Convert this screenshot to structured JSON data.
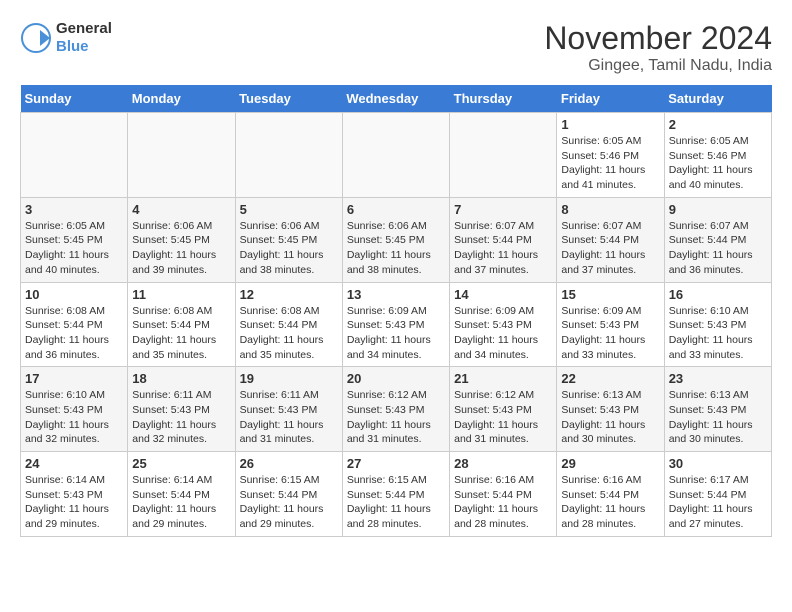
{
  "logo": {
    "line1": "General",
    "line2": "Blue"
  },
  "title": "November 2024",
  "subtitle": "Gingee, Tamil Nadu, India",
  "weekdays": [
    "Sunday",
    "Monday",
    "Tuesday",
    "Wednesday",
    "Thursday",
    "Friday",
    "Saturday"
  ],
  "weeks": [
    [
      {
        "day": "",
        "info": ""
      },
      {
        "day": "",
        "info": ""
      },
      {
        "day": "",
        "info": ""
      },
      {
        "day": "",
        "info": ""
      },
      {
        "day": "",
        "info": ""
      },
      {
        "day": "1",
        "info": "Sunrise: 6:05 AM\nSunset: 5:46 PM\nDaylight: 11 hours and 41 minutes."
      },
      {
        "day": "2",
        "info": "Sunrise: 6:05 AM\nSunset: 5:46 PM\nDaylight: 11 hours and 40 minutes."
      }
    ],
    [
      {
        "day": "3",
        "info": "Sunrise: 6:05 AM\nSunset: 5:45 PM\nDaylight: 11 hours and 40 minutes."
      },
      {
        "day": "4",
        "info": "Sunrise: 6:06 AM\nSunset: 5:45 PM\nDaylight: 11 hours and 39 minutes."
      },
      {
        "day": "5",
        "info": "Sunrise: 6:06 AM\nSunset: 5:45 PM\nDaylight: 11 hours and 38 minutes."
      },
      {
        "day": "6",
        "info": "Sunrise: 6:06 AM\nSunset: 5:45 PM\nDaylight: 11 hours and 38 minutes."
      },
      {
        "day": "7",
        "info": "Sunrise: 6:07 AM\nSunset: 5:44 PM\nDaylight: 11 hours and 37 minutes."
      },
      {
        "day": "8",
        "info": "Sunrise: 6:07 AM\nSunset: 5:44 PM\nDaylight: 11 hours and 37 minutes."
      },
      {
        "day": "9",
        "info": "Sunrise: 6:07 AM\nSunset: 5:44 PM\nDaylight: 11 hours and 36 minutes."
      }
    ],
    [
      {
        "day": "10",
        "info": "Sunrise: 6:08 AM\nSunset: 5:44 PM\nDaylight: 11 hours and 36 minutes."
      },
      {
        "day": "11",
        "info": "Sunrise: 6:08 AM\nSunset: 5:44 PM\nDaylight: 11 hours and 35 minutes."
      },
      {
        "day": "12",
        "info": "Sunrise: 6:08 AM\nSunset: 5:44 PM\nDaylight: 11 hours and 35 minutes."
      },
      {
        "day": "13",
        "info": "Sunrise: 6:09 AM\nSunset: 5:43 PM\nDaylight: 11 hours and 34 minutes."
      },
      {
        "day": "14",
        "info": "Sunrise: 6:09 AM\nSunset: 5:43 PM\nDaylight: 11 hours and 34 minutes."
      },
      {
        "day": "15",
        "info": "Sunrise: 6:09 AM\nSunset: 5:43 PM\nDaylight: 11 hours and 33 minutes."
      },
      {
        "day": "16",
        "info": "Sunrise: 6:10 AM\nSunset: 5:43 PM\nDaylight: 11 hours and 33 minutes."
      }
    ],
    [
      {
        "day": "17",
        "info": "Sunrise: 6:10 AM\nSunset: 5:43 PM\nDaylight: 11 hours and 32 minutes."
      },
      {
        "day": "18",
        "info": "Sunrise: 6:11 AM\nSunset: 5:43 PM\nDaylight: 11 hours and 32 minutes."
      },
      {
        "day": "19",
        "info": "Sunrise: 6:11 AM\nSunset: 5:43 PM\nDaylight: 11 hours and 31 minutes."
      },
      {
        "day": "20",
        "info": "Sunrise: 6:12 AM\nSunset: 5:43 PM\nDaylight: 11 hours and 31 minutes."
      },
      {
        "day": "21",
        "info": "Sunrise: 6:12 AM\nSunset: 5:43 PM\nDaylight: 11 hours and 31 minutes."
      },
      {
        "day": "22",
        "info": "Sunrise: 6:13 AM\nSunset: 5:43 PM\nDaylight: 11 hours and 30 minutes."
      },
      {
        "day": "23",
        "info": "Sunrise: 6:13 AM\nSunset: 5:43 PM\nDaylight: 11 hours and 30 minutes."
      }
    ],
    [
      {
        "day": "24",
        "info": "Sunrise: 6:14 AM\nSunset: 5:43 PM\nDaylight: 11 hours and 29 minutes."
      },
      {
        "day": "25",
        "info": "Sunrise: 6:14 AM\nSunset: 5:44 PM\nDaylight: 11 hours and 29 minutes."
      },
      {
        "day": "26",
        "info": "Sunrise: 6:15 AM\nSunset: 5:44 PM\nDaylight: 11 hours and 29 minutes."
      },
      {
        "day": "27",
        "info": "Sunrise: 6:15 AM\nSunset: 5:44 PM\nDaylight: 11 hours and 28 minutes."
      },
      {
        "day": "28",
        "info": "Sunrise: 6:16 AM\nSunset: 5:44 PM\nDaylight: 11 hours and 28 minutes."
      },
      {
        "day": "29",
        "info": "Sunrise: 6:16 AM\nSunset: 5:44 PM\nDaylight: 11 hours and 28 minutes."
      },
      {
        "day": "30",
        "info": "Sunrise: 6:17 AM\nSunset: 5:44 PM\nDaylight: 11 hours and 27 minutes."
      }
    ]
  ]
}
